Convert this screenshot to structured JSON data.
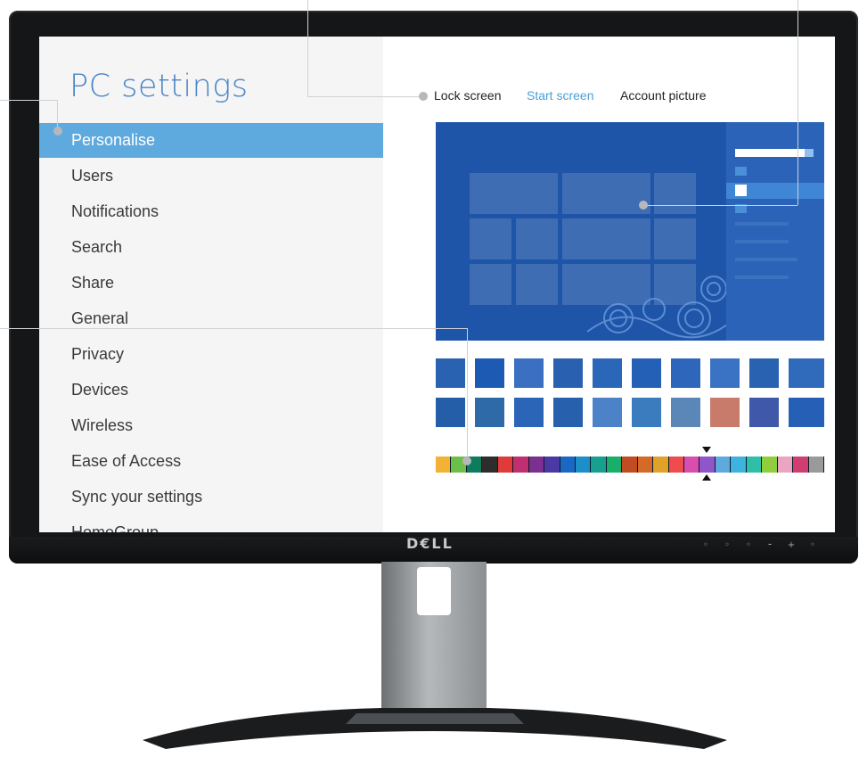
{
  "brand": "D€LL",
  "settings": {
    "title": "PC settings",
    "nav": [
      {
        "label": "Personalise",
        "selected": true
      },
      {
        "label": "Users"
      },
      {
        "label": "Notifications"
      },
      {
        "label": "Search"
      },
      {
        "label": "Share"
      },
      {
        "label": "General"
      },
      {
        "label": "Privacy"
      },
      {
        "label": "Devices"
      },
      {
        "label": "Wireless"
      },
      {
        "label": "Ease of Access"
      },
      {
        "label": "Sync your settings"
      },
      {
        "label": "HomeGroup"
      }
    ],
    "tabs": [
      {
        "label": "Lock screen"
      },
      {
        "label": "Start screen",
        "active": true
      },
      {
        "label": "Account picture"
      }
    ]
  },
  "colors": {
    "accent": "#5ea9de",
    "preview_background": "#1f55a8",
    "swatches": [
      "#f2b233",
      "#6cc04a",
      "#0e7b5e",
      "#2d2d2d",
      "#e03a3a",
      "#c03071",
      "#7b2f8e",
      "#4b3aa3",
      "#1a68c6",
      "#1c8fc9",
      "#17a08f",
      "#19ae6a",
      "#c24c22",
      "#d36a27",
      "#e1a229",
      "#ef4d4d",
      "#d94dad",
      "#8f56c9",
      "#5ea9de",
      "#3eb3e0",
      "#2fbfa9",
      "#8fce3d",
      "#e9a5c2",
      "#cf3e6e",
      "#9a9a9a"
    ]
  }
}
